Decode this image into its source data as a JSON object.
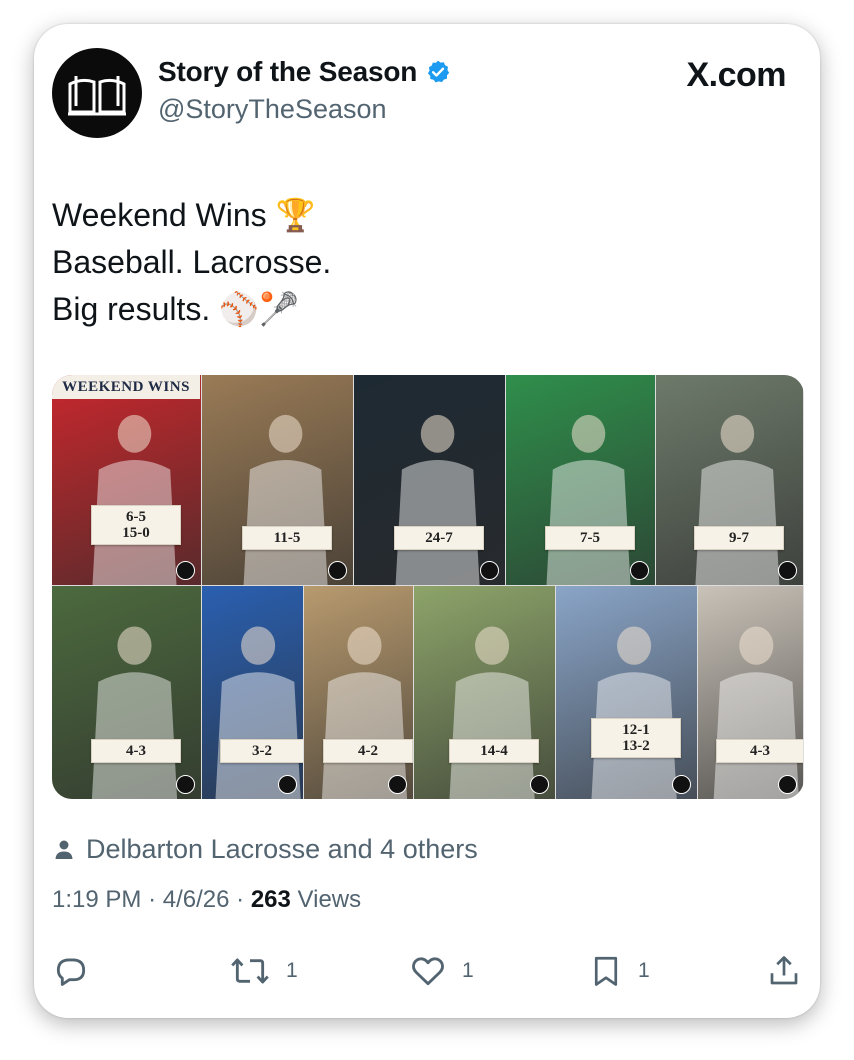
{
  "author": {
    "name": "Story of the Season",
    "handle": "@StoryTheSeason"
  },
  "brand": {
    "site": "X.com"
  },
  "tweet": {
    "lines": [
      "Weekend Wins 🏆",
      "Baseball. Lacrosse.",
      "Big results. ⚾🥍"
    ]
  },
  "media": {
    "banner": "WEEKEND WINS",
    "tiles": [
      {
        "scores": [
          "6-5",
          "15-0"
        ],
        "color": "#c8282d"
      },
      {
        "scores": [
          "11-5"
        ],
        "color": "#9a7b56"
      },
      {
        "scores": [
          "24-7"
        ],
        "color": "#1e2a33"
      },
      {
        "scores": [
          "7-5"
        ],
        "color": "#2f8f4c"
      },
      {
        "scores": [
          "9-7"
        ],
        "color": "#6d7a6a"
      },
      {
        "scores": [
          "4-3"
        ],
        "color": "#4c6a3e"
      },
      {
        "scores": [
          "3-2"
        ],
        "color": "#2a5fb0"
      },
      {
        "scores": [
          "4-2"
        ],
        "color": "#b89a6e"
      },
      {
        "scores": [
          "14-4"
        ],
        "color": "#8da46a"
      },
      {
        "scores": [
          "12-1",
          "13-2"
        ],
        "color": "#8aa5c8"
      },
      {
        "scores": [
          "4-3"
        ],
        "color": "#c9c2b8"
      }
    ]
  },
  "social_context": {
    "liked_by": "Delbarton Lacrosse and 4 others"
  },
  "meta": {
    "time": "1:19 PM",
    "date": "4/6/26",
    "views_count": "263",
    "views_label": "Views"
  },
  "actions": {
    "reply_count": "",
    "retweet_count": "1",
    "like_count": "1",
    "bookmark_count": "1"
  },
  "colors": {
    "verified": "#1d9bf0",
    "secondary_text": "#536471"
  }
}
